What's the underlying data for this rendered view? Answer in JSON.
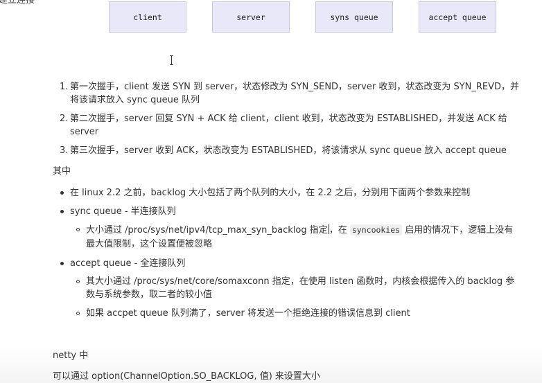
{
  "diagram": {
    "boxes": [
      "client",
      "server",
      "syns queue",
      "accept queue"
    ],
    "clipped_top_text": "建立连接"
  },
  "handshake_list": [
    {
      "number": "1.",
      "lines": [
        "第一次握手，client 发送 SYN 到 server，状态修改为 SYN_SEND，server 收到，状态改变为 SYN_REVD，并",
        "将该请求放入 sync queue 队列"
      ]
    },
    {
      "number": "2.",
      "lines": [
        "第二次握手，server 回复 SYN + ACK 给 client，client 收到，状态改变为 ESTABLISHED，并发送 ACK 给",
        "server"
      ]
    },
    {
      "number": "3.",
      "lines": [
        "第三次握手，server 收到 ACK，状态改变为 ESTABLISHED，将该请求从 sync queue 放入 accept queue"
      ]
    }
  ],
  "qizhong": "其中",
  "bullets": {
    "b1": "在 linux 2.2 之前，backlog 大小包括了两个队列的大小，在 2.2 之后，分别用下面两个参数来控制",
    "b2": "sync queue - 半连接队列",
    "b2_sub": {
      "line1_a": "大小通过 /proc/sys/net/ipv4/tcp_max_syn_backlog 指定",
      "line1_b": "，在",
      "line1_code": "syncookies",
      "line1_c": "启用的情况下，逻辑上没有",
      "line2": "最大值限制，这个设置便被忽略"
    },
    "b3": "accept queue - 全连接队列",
    "b3_sub1": {
      "line1": "其大小通过 /proc/sys/net/core/somaxconn 指定，在使用 listen 函数时，内核会根据传入的 backlog 参",
      "line2": "数与系统参数，取二者的较小值"
    },
    "b3_sub2": "如果 accpet queue 队列满了，server 将发送一个拒绝连接的错误信息到 client"
  },
  "netty": {
    "heading": "netty 中",
    "line": "可以通过  option(ChannelOption.SO_BACKLOG, 值) 来设置大小"
  }
}
